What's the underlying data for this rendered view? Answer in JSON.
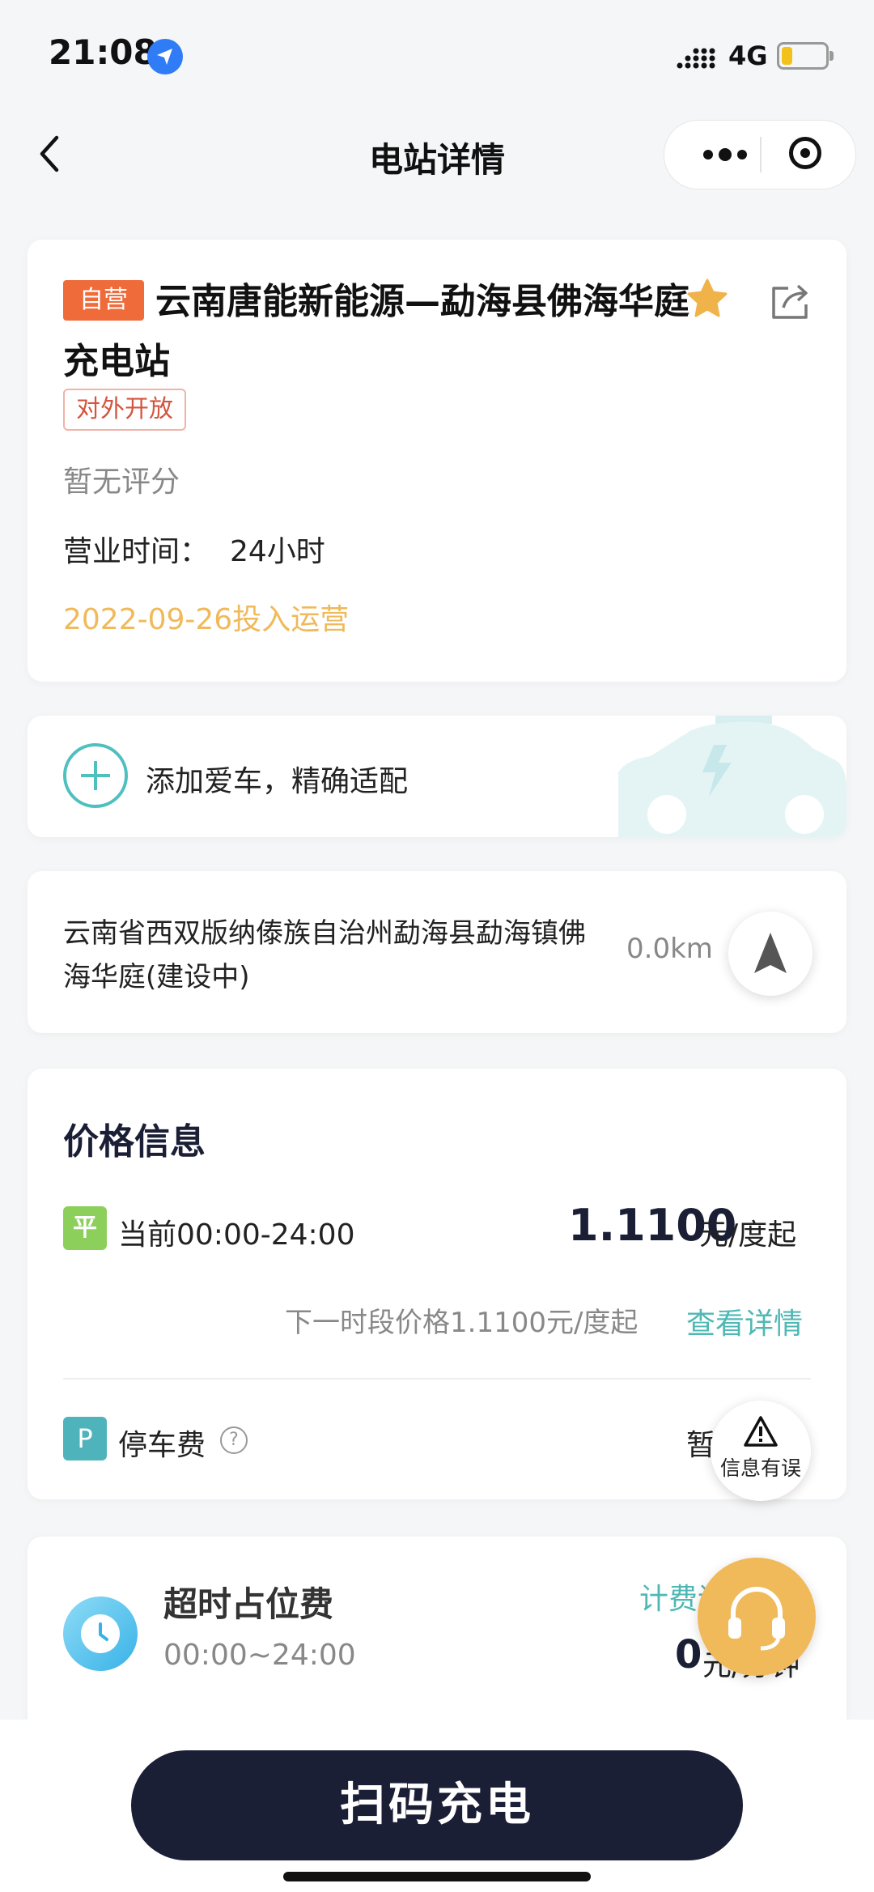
{
  "status_bar": {
    "time": "21:08",
    "network": "4G",
    "battery_level": 0.25
  },
  "nav": {
    "title": "电站详情"
  },
  "station": {
    "self_tag": "自营",
    "name": "云南唐能新能源—勐海县佛海华庭充电站",
    "open_tag": "对外开放",
    "rating": "暂无评分",
    "hours_label": "营业时间：",
    "hours_value": "24小时",
    "operation_date": "2022-09-26投入运营"
  },
  "add_car": {
    "label": "添加爱车，精确适配"
  },
  "address": {
    "text": "云南省西双版纳傣族自治州勐海县勐海镇佛海华庭(建设中)",
    "distance": "0.0km"
  },
  "price": {
    "title": "价格信息",
    "badge": "平",
    "period": "当前00:00-24:00",
    "value": "1.1100",
    "unit": "元/度起",
    "next": "下一时段价格1.1100元/度起",
    "detail_link": "查看详情",
    "parking_badge": "P",
    "parking_label": "停车费",
    "parking_help": "?",
    "parking_value": "暂"
  },
  "error_button": {
    "label": "信息有误"
  },
  "overtime": {
    "title": "超时占位费",
    "time": "00:00~24:00",
    "link": "计费说明",
    "price": "0",
    "unit": "元/分钟"
  },
  "bottom": {
    "scan_label": "扫码充电"
  },
  "colors": {
    "accent": "#4fb8b4",
    "primary_dark": "#1b1f36",
    "orange_tag": "#ef6b3a",
    "gold": "#f0b95a"
  }
}
